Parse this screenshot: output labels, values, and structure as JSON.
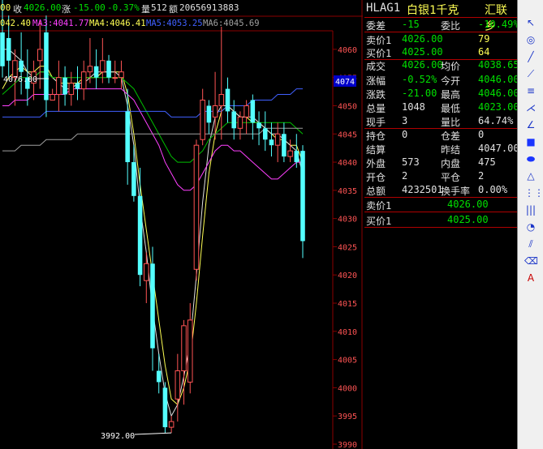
{
  "header": {
    "prefix": "00",
    "close_label": "收",
    "close_value": "4026.00",
    "change_label": "涨",
    "change_value": "-15.00",
    "change_pct": "-0.37%",
    "volume_label": "量",
    "volume_value": "512",
    "amount_label": "额",
    "amount_value": "2065691",
    "extra_value": "3883"
  },
  "ma_bar": {
    "ma1_text": "042.40",
    "ma3_text": "MA3:4041.77",
    "ma4_text": "MA4:4046.41",
    "ma5_text": "MA5:4053.25",
    "ma6_text": "MA6:4045.69"
  },
  "colors": {
    "up": "#ff5454",
    "down": "#54ffff",
    "ma3": "#ff40ff",
    "ma4": "#ffff54",
    "ma5": "#4060ff",
    "ma6": "#a0a0a0",
    "ma_green": "#00c000",
    "ma_white": "#e0e0e0",
    "grid": "#8b0000",
    "axis_text": "#ff5454"
  },
  "chart_data": {
    "type": "candlestick",
    "y_ticks": [
      "4060",
      "4055",
      "4050",
      "4045",
      "4040",
      "4035",
      "4030",
      "4025",
      "4020",
      "4015",
      "4010",
      "4005",
      "4000",
      "3995",
      "3990"
    ],
    "ylim": [
      3990,
      4063
    ],
    "current_price_tag": "4074",
    "annotations": [
      {
        "text": "4076.00"
      },
      {
        "text": "3992.00"
      }
    ],
    "candles": [
      {
        "o": 4063,
        "h": 4069,
        "l": 4055,
        "c": 4057
      },
      {
        "o": 4062,
        "h": 4066,
        "l": 4055,
        "c": 4058
      },
      {
        "o": 4055,
        "h": 4060,
        "l": 4050,
        "c": 4058
      },
      {
        "o": 4058,
        "h": 4063,
        "l": 4052,
        "c": 4056
      },
      {
        "o": 4055,
        "h": 4060,
        "l": 4050,
        "c": 4053
      },
      {
        "o": 4054,
        "h": 4058,
        "l": 4051,
        "c": 4056
      },
      {
        "o": 4058,
        "h": 4065,
        "l": 4053,
        "c": 4060
      },
      {
        "o": 4063,
        "h": 4066,
        "l": 4048,
        "c": 4051
      },
      {
        "o": 4051,
        "h": 4053,
        "l": 4051,
        "c": 4052
      },
      {
        "o": 4052,
        "h": 4058,
        "l": 4049,
        "c": 4055
      },
      {
        "o": 4055,
        "h": 4057,
        "l": 4050,
        "c": 4052
      },
      {
        "o": 4052,
        "h": 4056,
        "l": 4050,
        "c": 4054
      },
      {
        "o": 4054,
        "h": 4057,
        "l": 4051,
        "c": 4053
      },
      {
        "o": 4053,
        "h": 4058,
        "l": 4051,
        "c": 4056
      },
      {
        "o": 4056,
        "h": 4062,
        "l": 4054,
        "c": 4057
      },
      {
        "o": 4057,
        "h": 4060,
        "l": 4053,
        "c": 4055
      },
      {
        "o": 4056,
        "h": 4062,
        "l": 4054,
        "c": 4058
      },
      {
        "o": 4058,
        "h": 4059,
        "l": 4054,
        "c": 4055
      },
      {
        "o": 4055,
        "h": 4058,
        "l": 4054,
        "c": 4055
      },
      {
        "o": 4055,
        "h": 4058,
        "l": 4053,
        "c": 4056
      },
      {
        "o": 4049,
        "h": 4053,
        "l": 4036,
        "c": 4040
      },
      {
        "o": 4040,
        "h": 4043,
        "l": 4033,
        "c": 4034
      },
      {
        "o": 4034,
        "h": 4039,
        "l": 4018,
        "c": 4020
      },
      {
        "o": 4019,
        "h": 4024,
        "l": 4015,
        "c": 4022
      },
      {
        "o": 4022,
        "h": 4025,
        "l": 4003,
        "c": 4007
      },
      {
        "o": 4003,
        "h": 4006,
        "l": 3999,
        "c": 4001
      },
      {
        "o": 4000,
        "h": 4001,
        "l": 3992,
        "c": 3993
      },
      {
        "o": 3993,
        "h": 3995,
        "l": 3992,
        "c": 3994
      },
      {
        "o": 3998,
        "h": 4006,
        "l": 3994,
        "c": 4003
      },
      {
        "o": 4003,
        "h": 4012,
        "l": 3997,
        "c": 4011
      },
      {
        "o": 4001,
        "h": 4015,
        "l": 3999,
        "c": 4012
      },
      {
        "o": 4021,
        "h": 4044,
        "l": 4019,
        "c": 4043
      },
      {
        "o": 4044,
        "h": 4053,
        "l": 4043,
        "c": 4051
      },
      {
        "o": 4050,
        "h": 4051,
        "l": 4045,
        "c": 4047
      },
      {
        "o": 4048,
        "h": 4056,
        "l": 4044,
        "c": 4050
      },
      {
        "o": 4050,
        "h": 4064,
        "l": 4044,
        "c": 4052
      },
      {
        "o": 4053,
        "h": 4055,
        "l": 4047,
        "c": 4049
      },
      {
        "o": 4049,
        "h": 4051,
        "l": 4044,
        "c": 4046
      },
      {
        "o": 4046,
        "h": 4049,
        "l": 4044,
        "c": 4048
      },
      {
        "o": 4048,
        "h": 4051,
        "l": 4045,
        "c": 4050
      },
      {
        "o": 4051,
        "h": 4052,
        "l": 4044,
        "c": 4047
      },
      {
        "o": 4047,
        "h": 4049,
        "l": 4043,
        "c": 4046
      },
      {
        "o": 4046,
        "h": 4049,
        "l": 4042,
        "c": 4044
      },
      {
        "o": 4044,
        "h": 4047,
        "l": 4041,
        "c": 4043
      },
      {
        "o": 4043,
        "h": 4047,
        "l": 4040,
        "c": 4045
      },
      {
        "o": 4045,
        "h": 4047,
        "l": 4040,
        "c": 4041
      },
      {
        "o": 4041,
        "h": 4044,
        "l": 4040,
        "c": 4042
      },
      {
        "o": 4042,
        "h": 4045,
        "l": 4039,
        "c": 4040
      },
      {
        "o": 4042,
        "h": 4043,
        "l": 4023,
        "c": 4026
      }
    ],
    "ma_lines": [
      {
        "color_key": "ma4",
        "values": [
          4053,
          4055,
          4056,
          4057,
          4056,
          4056,
          4057,
          4057,
          4055,
          4054,
          4054,
          4054,
          4054,
          4055,
          4055,
          4055,
          4056,
          4056,
          4056,
          4056,
          4052,
          4045,
          4036,
          4028,
          4020,
          4012,
          4004,
          3998,
          3997,
          4000,
          4005,
          4015,
          4027,
          4038,
          4045,
          4049,
          4050,
          4049,
          4048,
          4048,
          4047,
          4047,
          4046,
          4045,
          4044,
          4044,
          4043,
          4043,
          4040
        ]
      },
      {
        "color_key": "ma_white",
        "values": [
          4060,
          4060,
          4059,
          4058,
          4056,
          4055,
          4056,
          4056,
          4055,
          4054,
          4053,
          4053,
          4054,
          4054,
          4055,
          4056,
          4056,
          4056,
          4056,
          4055,
          4050,
          4043,
          4032,
          4024,
          4014,
          4006,
          3999,
          3995,
          3997,
          4002,
          4008,
          4020,
          4033,
          4043,
          4048,
          4050,
          4050,
          4049,
          4048,
          4048,
          4048,
          4047,
          4046,
          4045,
          4045,
          4044,
          4043,
          4042,
          4038
        ]
      },
      {
        "color_key": "ma_green",
        "values": [
          4052,
          4053,
          4054,
          4055,
          4055,
          4055,
          4056,
          4056,
          4055,
          4055,
          4055,
          4055,
          4055,
          4055,
          4055,
          4055,
          4055,
          4055,
          4055,
          4055,
          4054,
          4053,
          4051,
          4049,
          4047,
          4045,
          4043,
          4041,
          4040,
          4040,
          4040,
          4041,
          4042,
          4044,
          4045,
          4046,
          4047,
          4047,
          4047,
          4047,
          4047,
          4047,
          4047,
          4047,
          4047,
          4047,
          4047,
          4046,
          4045
        ]
      },
      {
        "color_key": "ma3",
        "values": [
          4050,
          4050,
          4051,
          4051,
          4051,
          4052,
          4052,
          4052,
          4052,
          4052,
          4052,
          4053,
          4053,
          4053,
          4053,
          4053,
          4053,
          4053,
          4053,
          4053,
          4052,
          4051,
          4049,
          4047,
          4045,
          4043,
          4040,
          4038,
          4036,
          4035,
          4035,
          4036,
          4038,
          4040,
          4042,
          4043,
          4043,
          4042,
          4042,
          4041,
          4040,
          4039,
          4038,
          4037,
          4037,
          4038,
          4039,
          4040,
          4040
        ]
      },
      {
        "color_key": "ma5",
        "values": [
          4048,
          4048,
          4048,
          4048,
          4048,
          4048,
          4048,
          4049,
          4049,
          4049,
          4049,
          4049,
          4049,
          4049,
          4049,
          4049,
          4049,
          4049,
          4049,
          4049,
          4049,
          4049,
          4049,
          4049,
          4049,
          4049,
          4049,
          4048,
          4048,
          4048,
          4048,
          4048,
          4049,
          4049,
          4049,
          4049,
          4050,
          4050,
          4050,
          4050,
          4051,
          4051,
          4051,
          4051,
          4052,
          4052,
          4052,
          4053,
          4053
        ]
      },
      {
        "color_key": "ma6",
        "values": [
          4042,
          4042,
          4042,
          4043,
          4043,
          4043,
          4043,
          4044,
          4044,
          4044,
          4044,
          4044,
          4045,
          4045,
          4045,
          4045,
          4045,
          4045,
          4045,
          4045,
          4045,
          4045,
          4045,
          4045,
          4045,
          4045,
          4045,
          4045,
          4045,
          4045,
          4045,
          4045,
          4045,
          4045,
          4045,
          4045,
          4045,
          4045,
          4045,
          4045,
          4045,
          4045,
          4046,
          4046,
          4046,
          4046,
          4046,
          4046,
          4046
        ]
      }
    ]
  },
  "info_panel": {
    "symbol": "HLAG1",
    "name": "白银1千克",
    "exchange": "汇联乡",
    "rows": [
      {
        "l1": "委差",
        "v1": "-15",
        "l2": "委比",
        "v2": "-10.49%",
        "c1": "green",
        "c2": "green"
      },
      {
        "l1": "卖价1",
        "v1": "4026.00",
        "l2": "",
        "v2": "79",
        "c1": "green",
        "c2": "yellow"
      },
      {
        "l1": "买价1",
        "v1": "4025.00",
        "l2": "",
        "v2": "64",
        "c1": "green",
        "c2": "yellow"
      },
      {
        "l1": "成交",
        "v1": "4026.00",
        "l2": "均价",
        "v2": "4038.65",
        "c1": "green",
        "c2": "green"
      },
      {
        "l1": "涨幅",
        "v1": "-0.52%",
        "l2": "今开",
        "v2": "4046.00",
        "c1": "green",
        "c2": "green"
      },
      {
        "l1": "涨跌",
        "v1": "-21.00",
        "l2": "最高",
        "v2": "4046.00",
        "c1": "green",
        "c2": "green"
      },
      {
        "l1": "总量",
        "v1": "1048",
        "l2": "最低",
        "v2": "4023.00",
        "c1": "white",
        "c2": "green"
      },
      {
        "l1": "现手",
        "v1": "3",
        "l2": "量比",
        "v2": "64.74%",
        "c1": "white",
        "c2": "white"
      },
      {
        "l1": "持仓",
        "v1": "0",
        "l2": "仓差",
        "v2": "0",
        "c1": "white",
        "c2": "white"
      },
      {
        "l1": "结算",
        "v1": "",
        "l2": "昨结",
        "v2": "4047.00",
        "c1": "white",
        "c2": "white"
      },
      {
        "l1": "外盘",
        "v1": "573",
        "l2": "内盘",
        "v2": "475",
        "c1": "white",
        "c2": "white"
      },
      {
        "l1": "开仓",
        "v1": "2",
        "l2": "平仓",
        "v2": "2",
        "c1": "white",
        "c2": "white"
      },
      {
        "l1": "总额",
        "v1": "4232501",
        "l2": "换手率",
        "v2": "0.00%",
        "c1": "white",
        "c2": "white"
      }
    ],
    "sell1_label": "卖价1",
    "sell1_value": "4026.00",
    "buy1_label": "买价1",
    "buy1_value": "4025.00"
  },
  "toolbar": {
    "tools": [
      {
        "name": "cursor-arrow-icon",
        "glyph": "↖"
      },
      {
        "name": "circle-target-icon",
        "glyph": "◎"
      },
      {
        "name": "line-tool-icon",
        "glyph": "╱"
      },
      {
        "name": "ray-tool-icon",
        "glyph": "⟋"
      },
      {
        "name": "parallel-lines-icon",
        "glyph": "≡"
      },
      {
        "name": "fan-lines-icon",
        "glyph": "⋌"
      },
      {
        "name": "angle-tool-icon",
        "glyph": "∠"
      },
      {
        "name": "rectangle-icon",
        "glyph": "■"
      },
      {
        "name": "ellipse-icon",
        "glyph": "⬬"
      },
      {
        "name": "triangle-icon",
        "glyph": "△"
      },
      {
        "name": "cycle-lines-icon",
        "glyph": "⋮⋮"
      },
      {
        "name": "vertical-lines-icon",
        "glyph": "|||"
      },
      {
        "name": "arc-tool-icon",
        "glyph": "◔"
      },
      {
        "name": "channel-tool-icon",
        "glyph": "⫽"
      },
      {
        "name": "eraser-icon",
        "glyph": "⌫"
      },
      {
        "name": "text-tool-icon",
        "glyph": "A"
      }
    ]
  }
}
